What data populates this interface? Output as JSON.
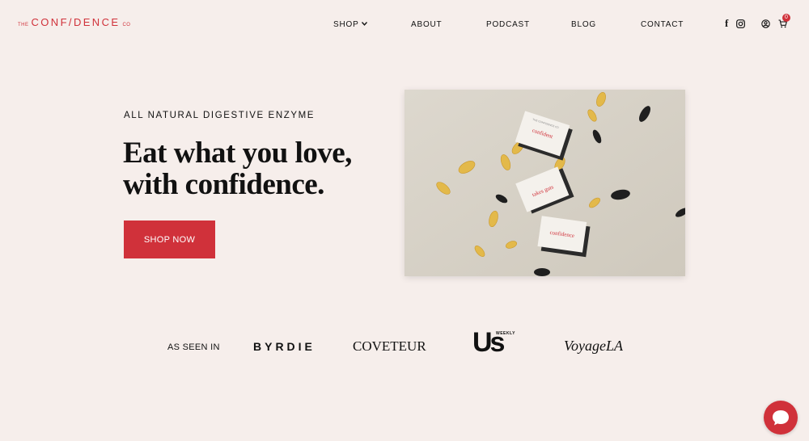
{
  "brand": {
    "prefix": "THE",
    "name": "CONF/DENCE",
    "suffix": "CO",
    "accent_color": "#d0313a",
    "background_color": "#f6eeeb"
  },
  "nav": {
    "items": [
      {
        "label": "SHOP",
        "has_dropdown": true
      },
      {
        "label": "ABOUT"
      },
      {
        "label": "PODCAST"
      },
      {
        "label": "BLOG"
      },
      {
        "label": "CONTACT"
      }
    ]
  },
  "header_icons": {
    "facebook": "facebook-icon",
    "instagram": "instagram-icon",
    "account": "user-icon",
    "cart": "cart-icon",
    "cart_count": "0"
  },
  "hero": {
    "eyebrow": "ALL NATURAL DIGESTIVE ENZYME",
    "headline_line1": "Eat what you love,",
    "headline_line2": "with confidence.",
    "cta_label": "SHOP NOW",
    "image": {
      "box_labels": [
        "THE CONFIDENCE CO",
        "confident",
        "takes guts",
        "confidence"
      ]
    }
  },
  "press": {
    "label": "AS SEEN IN",
    "logos": [
      "BYRDIE",
      "COVETEUR",
      "Us",
      "VoyageLA"
    ],
    "us_weekly_tag": "WEEKLY"
  },
  "chat": {
    "icon": "chat-bubble-icon"
  }
}
